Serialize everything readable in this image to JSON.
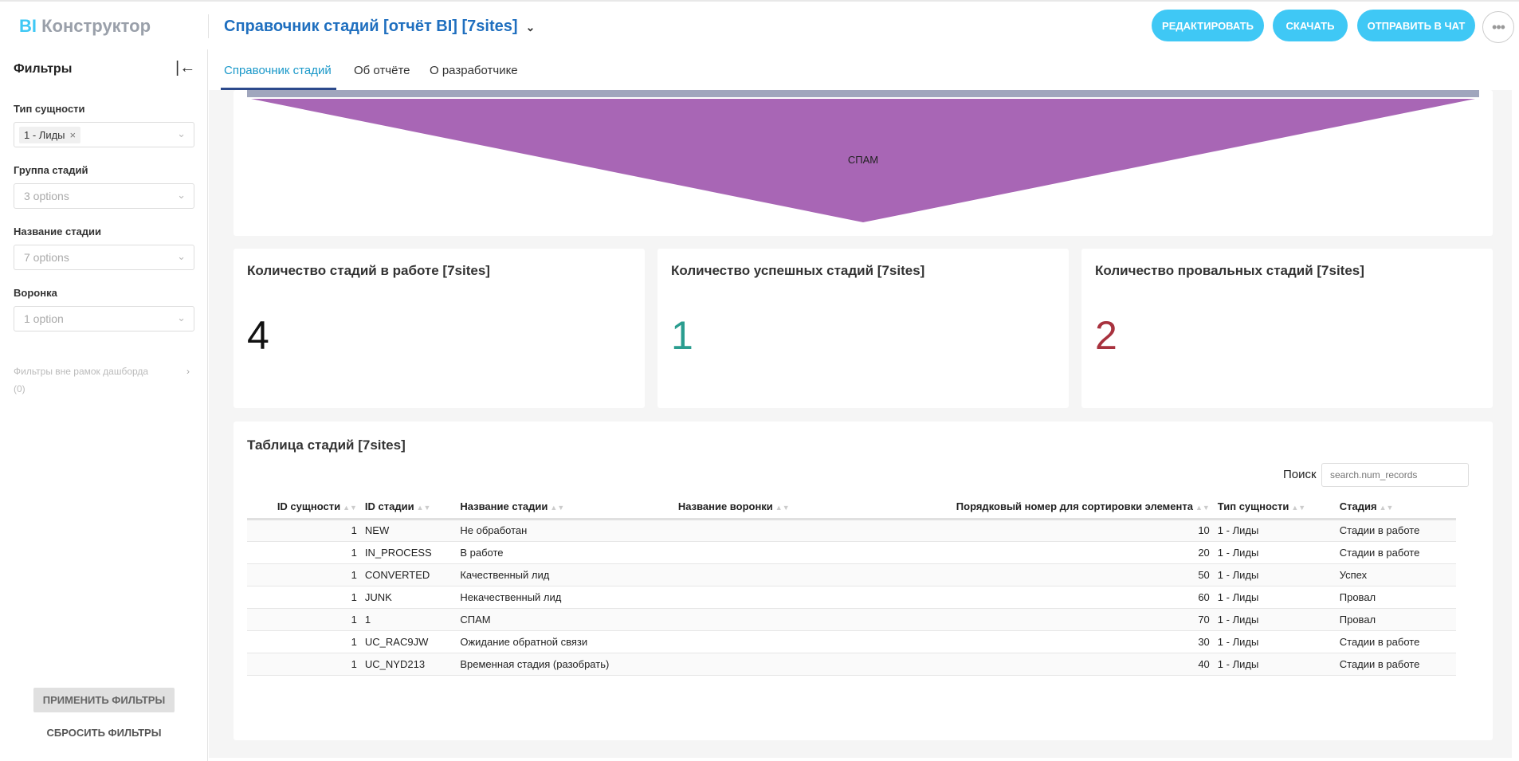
{
  "header": {
    "logo_accent": "BI",
    "logo_text": "Конструктор",
    "title": "Справочник стадий [отчёт BI] [7sites]",
    "buttons": {
      "edit": "РЕДАКТИРОВАТЬ",
      "download": "СКАЧАТЬ",
      "send": "ОТПРАВИТЬ В ЧАТ"
    },
    "more": "•••"
  },
  "sidebar": {
    "title": "Фильтры",
    "filters": [
      {
        "label": "Тип сущности",
        "tag": "1 - Лиды",
        "value": ""
      },
      {
        "label": "Группа стадий",
        "value": "3 options"
      },
      {
        "label": "Название стадии",
        "value": "7 options"
      },
      {
        "label": "Воронка",
        "value": "1 option"
      }
    ],
    "outside": "Фильтры вне рамок дашборда",
    "outside_count": "(0)",
    "apply": "ПРИМЕНИТЬ ФИЛЬТРЫ",
    "reset": "СБРОСИТЬ ФИЛЬТРЫ"
  },
  "tabs": [
    "Справочник стадий",
    "Об отчёте",
    "О разработчике"
  ],
  "funnel": {
    "label": "СПАМ",
    "colors": {
      "bar": "#a0a6bd",
      "funnel": "#a866b5"
    }
  },
  "kpis": [
    {
      "title": "Количество стадий в работе [7sites]",
      "value": "4",
      "color": "#111111"
    },
    {
      "title": "Количество успешных стадий [7sites]",
      "value": "1",
      "color": "#2a9d8f"
    },
    {
      "title": "Количество провальных стадий [7sites]",
      "value": "2",
      "color": "#a8323e"
    }
  ],
  "table": {
    "title": "Таблица стадий [7sites]",
    "search_label": "Поиск",
    "search_placeholder": "search.num_records",
    "columns": [
      "ID сущности",
      "ID стадии",
      "Название стадии",
      "Название воронки",
      "Порядковый номер для сортировки элемента",
      "Тип сущности",
      "Стадия"
    ],
    "rows": [
      [
        "1",
        "NEW",
        "Не обработан",
        "",
        "10",
        "1 - Лиды",
        "Стадии в работе"
      ],
      [
        "1",
        "IN_PROCESS",
        "В работе",
        "",
        "20",
        "1 - Лиды",
        "Стадии в работе"
      ],
      [
        "1",
        "CONVERTED",
        "Качественный лид",
        "",
        "50",
        "1 - Лиды",
        "Успех"
      ],
      [
        "1",
        "JUNK",
        "Некачественный лид",
        "",
        "60",
        "1 - Лиды",
        "Провал"
      ],
      [
        "1",
        "1",
        "СПАМ",
        "",
        "70",
        "1 - Лиды",
        "Провал"
      ],
      [
        "1",
        "UC_RAC9JW",
        "Ожидание обратной связи",
        "",
        "30",
        "1 - Лиды",
        "Стадии в работе"
      ],
      [
        "1",
        "UC_NYD213",
        "Временная стадия (разобрать)",
        "",
        "40",
        "1 - Лиды",
        "Стадии в работе"
      ]
    ]
  },
  "colors": {
    "accent": "#3fc8f5",
    "title": "#1f6fbf"
  }
}
